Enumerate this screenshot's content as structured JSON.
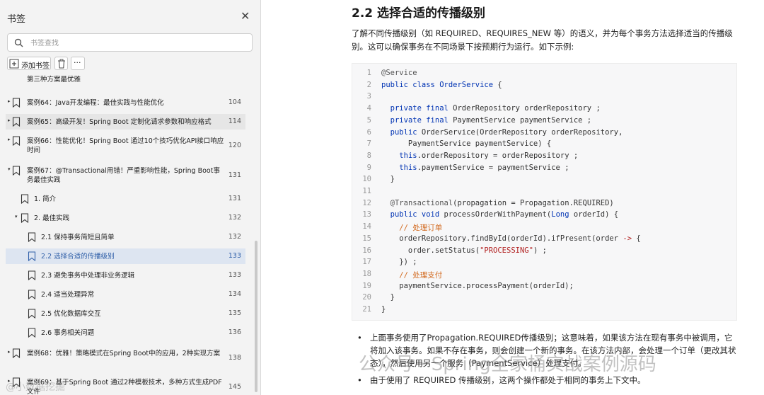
{
  "sidebar": {
    "title": "书签",
    "close_icon": "close-icon",
    "search": {
      "placeholder": "书签查找",
      "value": ""
    },
    "toolbar": {
      "add_label": "添加书签",
      "delete_icon": "trash-icon",
      "more_label": "···"
    },
    "partial_top": "第三种方案最优雅",
    "items": [
      {
        "text": "案例64：Java开发编程：最佳实践与性能优化",
        "page": "104",
        "level": 0,
        "arrow": "▸"
      },
      {
        "text": "案例65：高级开发！Spring Boot 定制化请求参数和响应格式",
        "page": "114",
        "level": 0,
        "arrow": "▸"
      },
      {
        "text": "案例66：性能优化！Spring Boot 通过10个技巧优化API接口响应时间",
        "page": "120",
        "level": 0,
        "arrow": "▸"
      },
      {
        "text": "案例67：@Transactional用错！严重影响性能，Spring Boot事务最佳实践",
        "page": "131",
        "level": 0,
        "arrow": "▾"
      },
      {
        "text": "1. 简介",
        "page": "131",
        "level": 1,
        "arrow": ""
      },
      {
        "text": "2. 最佳实践",
        "page": "132",
        "level": 1,
        "arrow": "▾"
      },
      {
        "text": "2.1 保持事务简短且简单",
        "page": "132",
        "level": 2,
        "arrow": ""
      },
      {
        "text": "2.2 选择合适的传播级别",
        "page": "133",
        "level": 2,
        "arrow": ""
      },
      {
        "text": "2.3 避免事务中处理非业务逻辑",
        "page": "133",
        "level": 2,
        "arrow": ""
      },
      {
        "text": "2.4 适当处理异常",
        "page": "134",
        "level": 2,
        "arrow": ""
      },
      {
        "text": "2.5 优化数据库交互",
        "page": "135",
        "level": 2,
        "arrow": ""
      },
      {
        "text": "2.6 事务相关问题",
        "page": "136",
        "level": 2,
        "arrow": ""
      },
      {
        "text": "案例68：优雅！策略模式在Spring Boot中的应用，2种实现方案",
        "page": "138",
        "level": 0,
        "arrow": "▸"
      },
      {
        "text": "案例69：基于Spring Boot 通过2种模板技术，多种方式生成PDF文件",
        "page": "145",
        "level": 0,
        "arrow": "▸"
      }
    ]
  },
  "content": {
    "heading": "2.2 选择合适的传播级别",
    "intro": "了解不同传播级别（如 REQUIRED、REQUIRES_NEW 等）的语义，并为每个事务方法选择适当的传播级别。这可以确保事务在不同场景下按预期行为运行。如下示例:",
    "code_lines": [
      "1",
      "2",
      "3",
      "4",
      "5",
      "6",
      "7",
      "8",
      "9",
      "10",
      "11",
      "12",
      "13",
      "14",
      "15",
      "16",
      "17",
      "18",
      "19",
      "20",
      "21"
    ],
    "bullets": [
      "上面事务使用了Propagation.REQUIRED传播级别；这意味着，如果该方法在现有事务中被调用，它将加入该事务。如果不存在事务，则会创建一个新的事务。在该方法内部，会处理一个订单（更改其状态），然后使用另一个服务（PaymentService）处理支付。",
      "由于使用了 REQUIRED 传播级别，这两个操作都处于相同的事务上下文中。"
    ],
    "watermark": "公众号 · Spring全家桶实战案例源码",
    "watermark_small": "@小数据挖掘"
  },
  "colors": {
    "keyword": "#0033b3",
    "comment": "#d2691e",
    "string": "#b22222",
    "selected_bg": "#dde5f1",
    "selected_text": "#2f5fa8"
  }
}
